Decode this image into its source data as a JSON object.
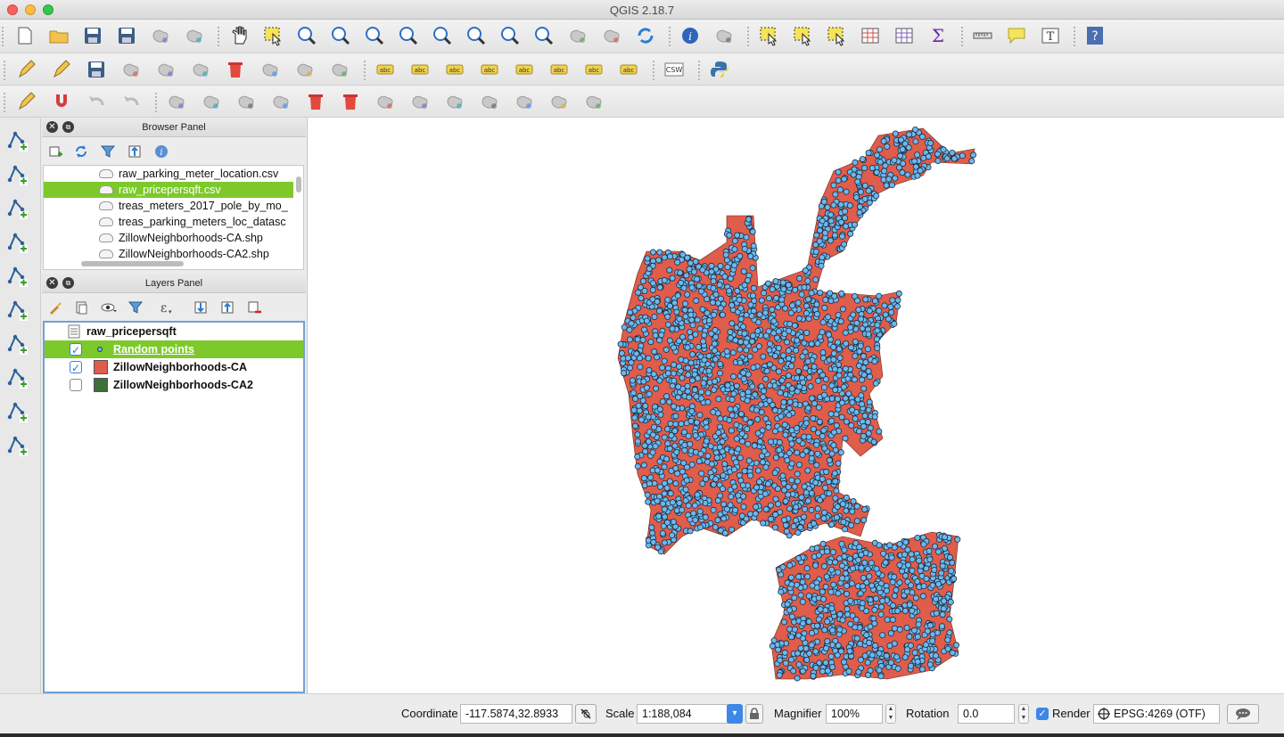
{
  "window": {
    "title": "QGIS 2.18.7"
  },
  "colors": {
    "accent_selected": "#7dc92b",
    "map_points_fill": "#6cb8ef",
    "map_points_stroke": "#1a2e40",
    "polygon_fill": "#e05c4b",
    "zillow_ca2_swatch": "#3f6f3a"
  },
  "toolbars": {
    "row1": [
      "new-project-icon",
      "open-project-icon",
      "save-project-icon",
      "save-as-icon",
      "new-print-composer-icon",
      "composer-manager-icon",
      "pan-map-icon",
      "pan-to-selection-icon",
      "zoom-in-icon",
      "zoom-out-icon",
      "zoom-native-icon",
      "zoom-full-icon",
      "zoom-to-selection-icon",
      "zoom-to-layer-icon",
      "zoom-last-icon",
      "zoom-next-icon",
      "new-bookmark-icon",
      "show-bookmarks-icon",
      "refresh-icon",
      "identify-icon",
      "run-feature-action-icon",
      "select-features-icon",
      "select-by-expression-icon",
      "deselect-icon",
      "attribute-table-icon",
      "field-calculator-icon",
      "statistical-summary-icon",
      "measure-line-icon",
      "map-tips-icon",
      "text-annotation-icon",
      "help-icon"
    ],
    "row2": [
      "current-edits-icon",
      "toggle-editing-icon",
      "save-edits-icon",
      "add-feature-icon",
      "move-feature-icon",
      "node-tool-icon",
      "delete-selected-icon",
      "cut-features-icon",
      "copy-features-icon",
      "paste-features-icon",
      "label-icon",
      "diagram-icon",
      "pin-labels-icon",
      "show-hide-labels-icon",
      "show-pinned-labels-icon",
      "move-label-icon",
      "rotate-label-icon",
      "change-label-icon",
      "csw-icon",
      "python-console-icon"
    ],
    "row3": [
      "digitizing-icon",
      "enable-snapping-icon",
      "undo-icon",
      "redo-icon",
      "simplify-feature-icon",
      "add-ring-icon",
      "add-part-icon",
      "fill-ring-icon",
      "delete-ring-icon",
      "delete-part-icon",
      "reshape-features-icon",
      "offset-curve-icon",
      "split-features-icon",
      "split-parts-icon",
      "merge-features-icon",
      "merge-attributes-icon",
      "rotate-point-symbols-icon"
    ]
  },
  "browser_panel": {
    "title": "Browser Panel",
    "items": [
      {
        "label": "raw_parking_meter_location.csv",
        "selected": false
      },
      {
        "label": "raw_pricepersqft.csv",
        "selected": true
      },
      {
        "label": "treas_meters_2017_pole_by_mo_",
        "selected": false
      },
      {
        "label": "treas_parking_meters_loc_datasc",
        "selected": false
      },
      {
        "label": "ZillowNeighborhoods-CA.shp",
        "selected": false
      },
      {
        "label": "ZillowNeighborhoods-CA2.shp",
        "selected": false
      }
    ]
  },
  "layers_panel": {
    "title": "Layers Panel",
    "items": [
      {
        "label": "raw_pricepersqft",
        "checked": null,
        "selected": false
      },
      {
        "label": "Random points",
        "checked": true,
        "selected": true
      },
      {
        "label": "ZillowNeighborhoods-CA",
        "checked": true,
        "selected": false
      },
      {
        "label": "ZillowNeighborhoods-CA2",
        "checked": false,
        "selected": false
      }
    ]
  },
  "status": {
    "coordinate_label": "Coordinate",
    "coordinate_value": "-117.5874,32.8933",
    "scale_label": "Scale",
    "scale_value": "1:188,084",
    "magnifier_label": "Magnifier",
    "magnifier_value": "100%",
    "rotation_label": "Rotation",
    "rotation_value": "0.0",
    "render_label": "Render",
    "render_checked": true,
    "crs_label": "EPSG:4269 (OTF)"
  }
}
